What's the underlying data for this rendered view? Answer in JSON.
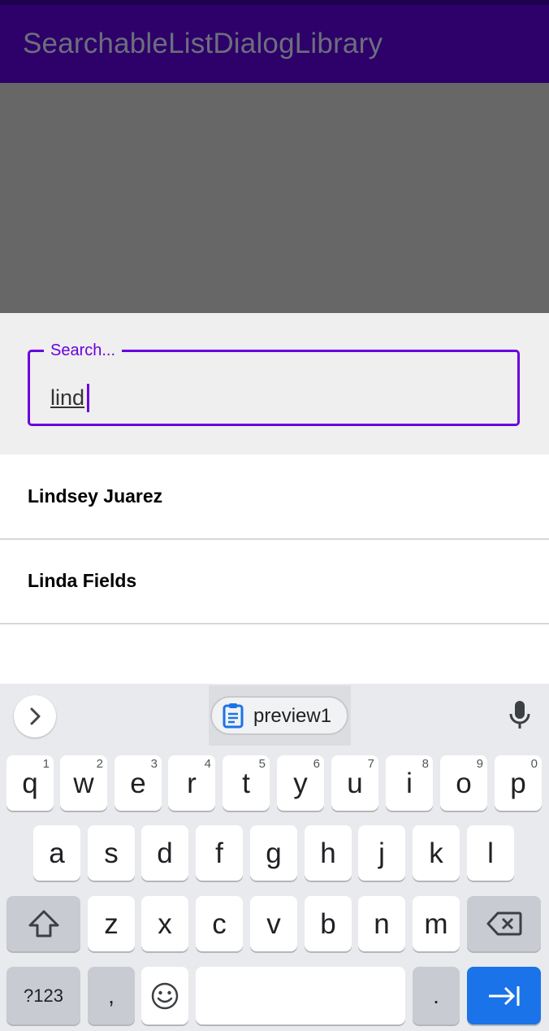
{
  "app": {
    "title": "SearchableListDialogLibrary"
  },
  "search": {
    "label": "Search...",
    "value": "lind"
  },
  "results": [
    {
      "name": "Lindsey Juarez"
    },
    {
      "name": "Linda Fields"
    }
  ],
  "keyboard": {
    "suggestion_chip": "preview1",
    "row1": [
      {
        "key": "q",
        "hint": "1"
      },
      {
        "key": "w",
        "hint": "2"
      },
      {
        "key": "e",
        "hint": "3"
      },
      {
        "key": "r",
        "hint": "4"
      },
      {
        "key": "t",
        "hint": "5"
      },
      {
        "key": "y",
        "hint": "6"
      },
      {
        "key": "u",
        "hint": "7"
      },
      {
        "key": "i",
        "hint": "8"
      },
      {
        "key": "o",
        "hint": "9"
      },
      {
        "key": "p",
        "hint": "0"
      }
    ],
    "row2": [
      "a",
      "s",
      "d",
      "f",
      "g",
      "h",
      "j",
      "k",
      "l"
    ],
    "row3": [
      "z",
      "x",
      "c",
      "v",
      "b",
      "n",
      "m"
    ],
    "symbols_label": "?123",
    "comma": ",",
    "period": "."
  }
}
